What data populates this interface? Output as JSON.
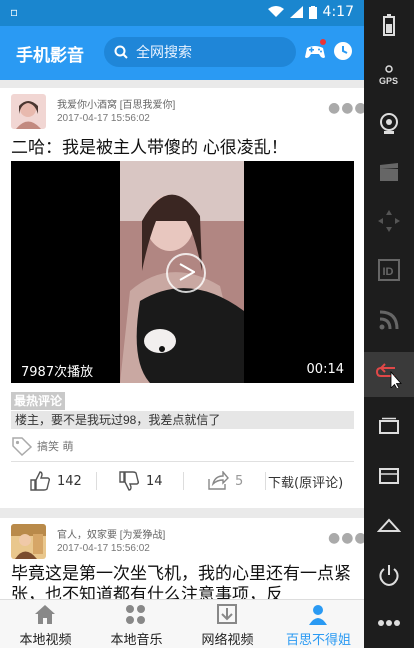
{
  "status": {
    "time": "4:17"
  },
  "appbar": {
    "title": "手机影音",
    "search_placeholder": "全网搜索"
  },
  "posts": [
    {
      "user": "我爱你小酒窝 [百思我爱你]",
      "time": "2017-04-17 15:56:02",
      "title": "二哈：我是被主人带傻的 心很凌乱！",
      "play_count": "7987次播放",
      "duration": "00:14",
      "hot_label": "最热评论",
      "hot_comment": "楼主，要不是我玩过98，我差点就信了",
      "tags": "搞笑 萌",
      "likes": "142",
      "dislikes": "14",
      "shares": "5",
      "download_label": "下载(原评论)"
    },
    {
      "user": "官人，奴家要 [为爱狰战]",
      "time": "2017-04-17 15:56:02",
      "title": "毕竟这是第一次坐飞机，我的心里还有一点紧张，也不知道都有什么注意事项，反"
    }
  ],
  "tabs": [
    {
      "label": "本地视频",
      "icon": "home-icon"
    },
    {
      "label": "本地音乐",
      "icon": "grid-icon"
    },
    {
      "label": "网络视频",
      "icon": "download-icon"
    },
    {
      "label": "百思不得姐",
      "icon": "person-icon",
      "active": true
    }
  ],
  "colors": {
    "accent": "#2a9af3",
    "statusbar": "#1a86cf"
  }
}
